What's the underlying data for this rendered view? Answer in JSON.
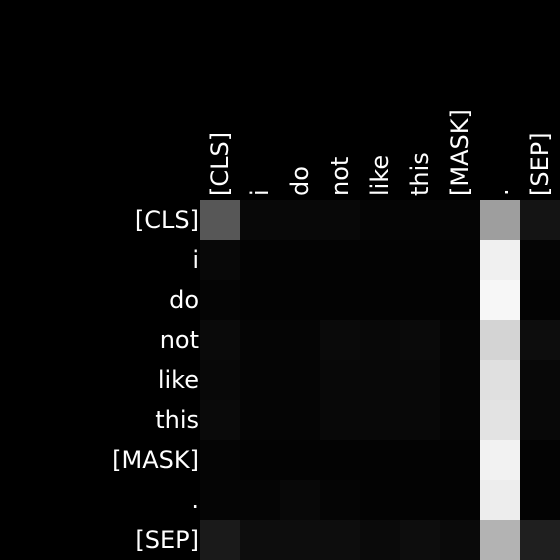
{
  "chart_data": {
    "type": "heatmap",
    "x_tokens": [
      "[CLS]",
      "i",
      "do",
      "not",
      "like",
      "this",
      "[MASK]",
      ".",
      "[SEP]"
    ],
    "y_tokens": [
      "[CLS]",
      "i",
      "do",
      "not",
      "like",
      "this",
      "[MASK]",
      ".",
      "[SEP]"
    ],
    "value_range": [
      0,
      1
    ],
    "colormap": "grayscale",
    "values": [
      [
        0.34,
        0.03,
        0.03,
        0.03,
        0.02,
        0.02,
        0.02,
        0.62,
        0.08
      ],
      [
        0.03,
        0.01,
        0.01,
        0.01,
        0.01,
        0.01,
        0.01,
        0.94,
        0.02
      ],
      [
        0.02,
        0.01,
        0.01,
        0.01,
        0.01,
        0.01,
        0.01,
        0.97,
        0.01
      ],
      [
        0.04,
        0.02,
        0.02,
        0.04,
        0.03,
        0.04,
        0.02,
        0.83,
        0.05
      ],
      [
        0.03,
        0.02,
        0.02,
        0.03,
        0.03,
        0.03,
        0.02,
        0.88,
        0.03
      ],
      [
        0.04,
        0.02,
        0.02,
        0.03,
        0.03,
        0.03,
        0.02,
        0.89,
        0.03
      ],
      [
        0.02,
        0.01,
        0.01,
        0.01,
        0.01,
        0.01,
        0.01,
        0.95,
        0.01
      ],
      [
        0.02,
        0.02,
        0.03,
        0.02,
        0.01,
        0.01,
        0.01,
        0.93,
        0.01
      ],
      [
        0.1,
        0.05,
        0.05,
        0.05,
        0.04,
        0.05,
        0.04,
        0.7,
        0.12
      ]
    ]
  }
}
